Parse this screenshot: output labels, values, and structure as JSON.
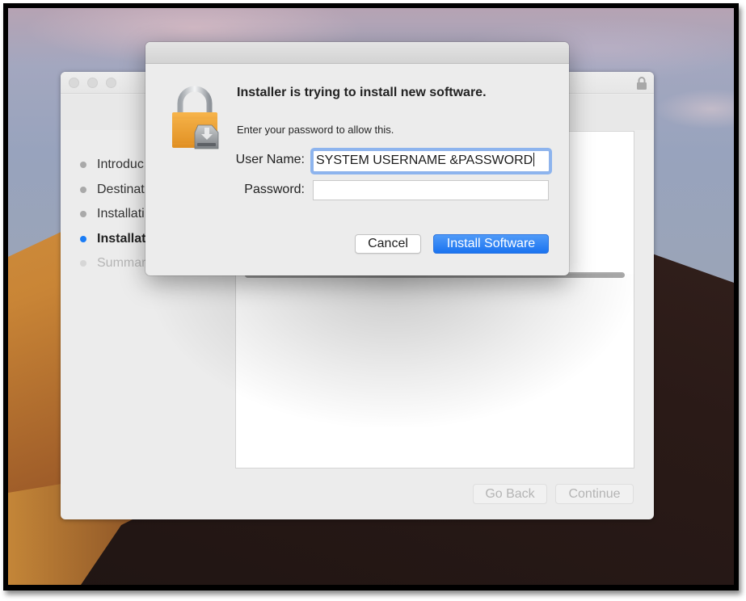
{
  "installer_window": {
    "steps": [
      {
        "label": "Introduc",
        "state": "done"
      },
      {
        "label": "Destinat",
        "state": "done"
      },
      {
        "label": "Installati",
        "state": "done"
      },
      {
        "label": "Installat",
        "state": "active"
      },
      {
        "label": "Summar",
        "state": "future"
      }
    ],
    "go_back_label": "Go Back",
    "continue_label": "Continue",
    "lock_icon": "lock-icon",
    "colors": {
      "active_step": "#1a7cf5"
    }
  },
  "auth_dialog": {
    "title": "Installer is trying to install new software.",
    "message": "Enter your password to allow this.",
    "username_label": "User Name:",
    "username_value": "SYSTEM USERNAME &PASSWORD",
    "password_label": "Password:",
    "password_value": "",
    "cancel_label": "Cancel",
    "install_label": "Install Software",
    "icon": "padlock-installer-icon",
    "colors": {
      "primary_button": "#1a73f0",
      "focus_ring": "#8db4ee"
    }
  }
}
